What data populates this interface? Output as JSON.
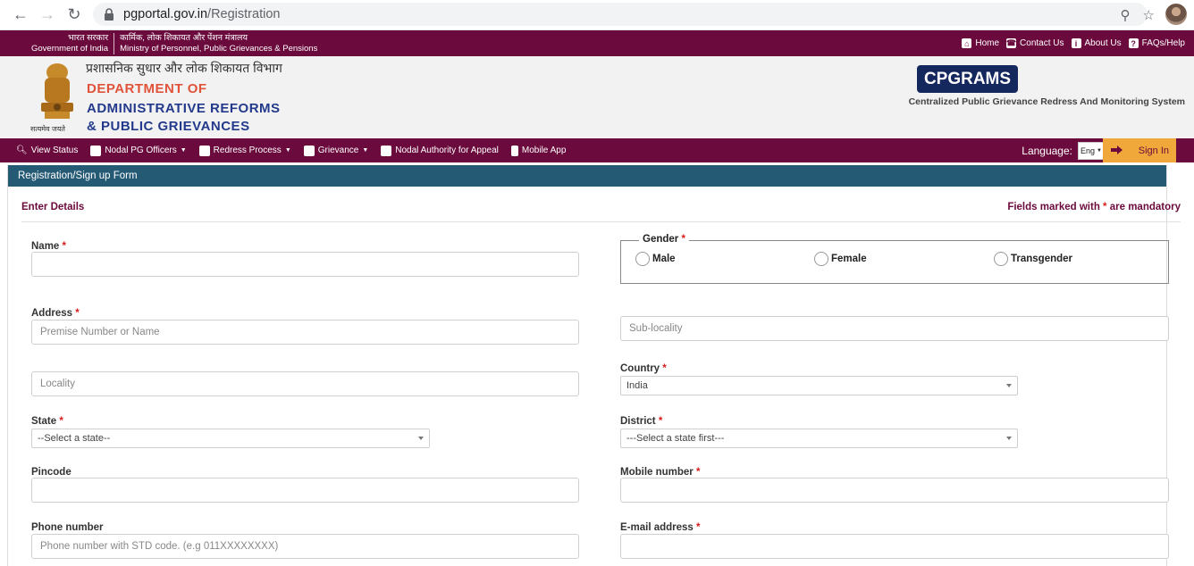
{
  "browser": {
    "url_host": "pgportal.gov.in",
    "url_path": "/Registration"
  },
  "topbar": {
    "gov_hi": "भारत सरकार",
    "gov_en": "Government of India",
    "ministry_hi": "कार्मिक, लोक शिकायत और पेंशन मंत्रालय",
    "ministry_en": "Ministry of Personnel, Public Grievances & Pensions",
    "links": [
      {
        "label": "Home",
        "icon": "home-icon"
      },
      {
        "label": "Contact Us",
        "icon": "phone-icon"
      },
      {
        "label": "About Us",
        "icon": "info-icon"
      },
      {
        "label": "FAQs/Help",
        "icon": "help-icon"
      }
    ]
  },
  "header": {
    "dept_hi": "प्रशासनिक सुधार और लोक शिकायत विभाग",
    "dept_line1": "DEPARTMENT OF",
    "dept_line2": "ADMINISTRATIVE REFORMS",
    "dept_line3": "& PUBLIC GRIEVANCES",
    "motto": "सत्यमेव जयते",
    "brand": "CPGRAMS",
    "brand_sub": "Centralized Public Grievance Redress And Monitoring System"
  },
  "menu": {
    "items": [
      {
        "label": "View Status",
        "caret": false
      },
      {
        "label": "Nodal PG Officers",
        "caret": true
      },
      {
        "label": "Redress Process",
        "caret": true
      },
      {
        "label": "Grievance",
        "caret": true
      },
      {
        "label": "Nodal Authority for Appeal",
        "caret": false
      },
      {
        "label": "Mobile App",
        "caret": false
      }
    ],
    "language_label": "Language:",
    "language_value": "Eng",
    "signin_label": "Sign In"
  },
  "form": {
    "panel_title": "Registration/Sign up Form",
    "section_title": "Enter Details",
    "mandatory_prefix": "Fields marked with",
    "mandatory_star": "*",
    "mandatory_suffix": "are mandatory",
    "name_label": "Name",
    "gender_label": "Gender",
    "gender_options": [
      "Male",
      "Female",
      "Transgender"
    ],
    "address_label": "Address",
    "premise_placeholder": "Premise Number or Name",
    "sublocality_placeholder": "Sub-locality",
    "locality_placeholder": "Locality",
    "country_label": "Country",
    "country_value": "India",
    "state_label": "State",
    "state_value": "--Select a state--",
    "district_label": "District",
    "district_value": "---Select a state first---",
    "pincode_label": "Pincode",
    "mobile_label": "Mobile number",
    "phone_label": "Phone number",
    "phone_placeholder": "Phone number with STD code. (e.g 011XXXXXXXX)",
    "email_label": "E-mail address",
    "required_mark": "*"
  }
}
